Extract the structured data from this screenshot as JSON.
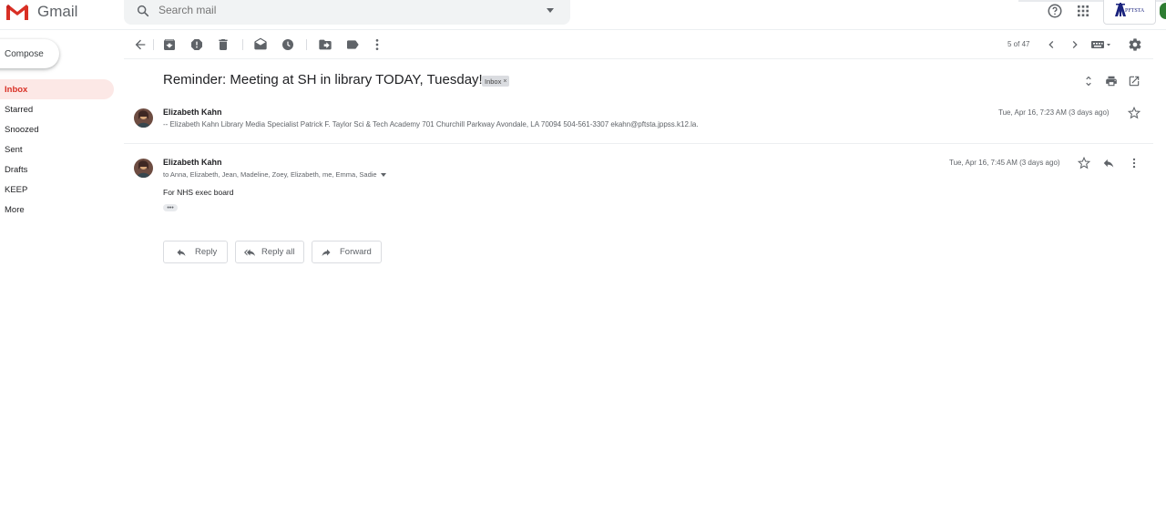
{
  "app": {
    "name": "Gmail"
  },
  "search": {
    "placeholder": "Search mail"
  },
  "account": {
    "text": "PFTSTA"
  },
  "sidebar": {
    "compose_label": "Compose",
    "items": [
      {
        "label": "Inbox",
        "active": true
      },
      {
        "label": "Starred"
      },
      {
        "label": "Snoozed"
      },
      {
        "label": "Sent"
      },
      {
        "label": "Drafts"
      },
      {
        "label": "KEEP"
      },
      {
        "label": "More"
      }
    ]
  },
  "toolbar": {
    "page_count": "5 of 47"
  },
  "thread": {
    "subject": "Reminder: Meeting at SH in library TODAY, Tuesday!",
    "label_chip": "Inbox",
    "label_chip_close": "×"
  },
  "messages": [
    {
      "sender": "Elizabeth Kahn",
      "snippet": "-- Elizabeth Kahn Library Media Specialist Patrick F. Taylor Sci & Tech Academy 701 Churchill Parkway Avondale, LA 70094 504-561-3307 ekahn@pftsta.jppss.k12.la.",
      "date": "Tue, Apr 16, 7:23 AM (3 days ago)"
    },
    {
      "sender": "Elizabeth Kahn",
      "recipients": "to Anna, Elizabeth, Jean, Madeline, Zoey, Elizabeth, me, Emma, Sadie",
      "date": "Tue, Apr 16, 7:45 AM (3 days ago)",
      "body": "For NHS exec board",
      "trimmed": "•••"
    }
  ],
  "actions": {
    "reply": "Reply",
    "reply_all": "Reply all",
    "forward": "Forward"
  },
  "colors": {
    "accent_red": "#d93025",
    "active_bg": "#fce8e6",
    "icon_gray": "#5f6368"
  }
}
